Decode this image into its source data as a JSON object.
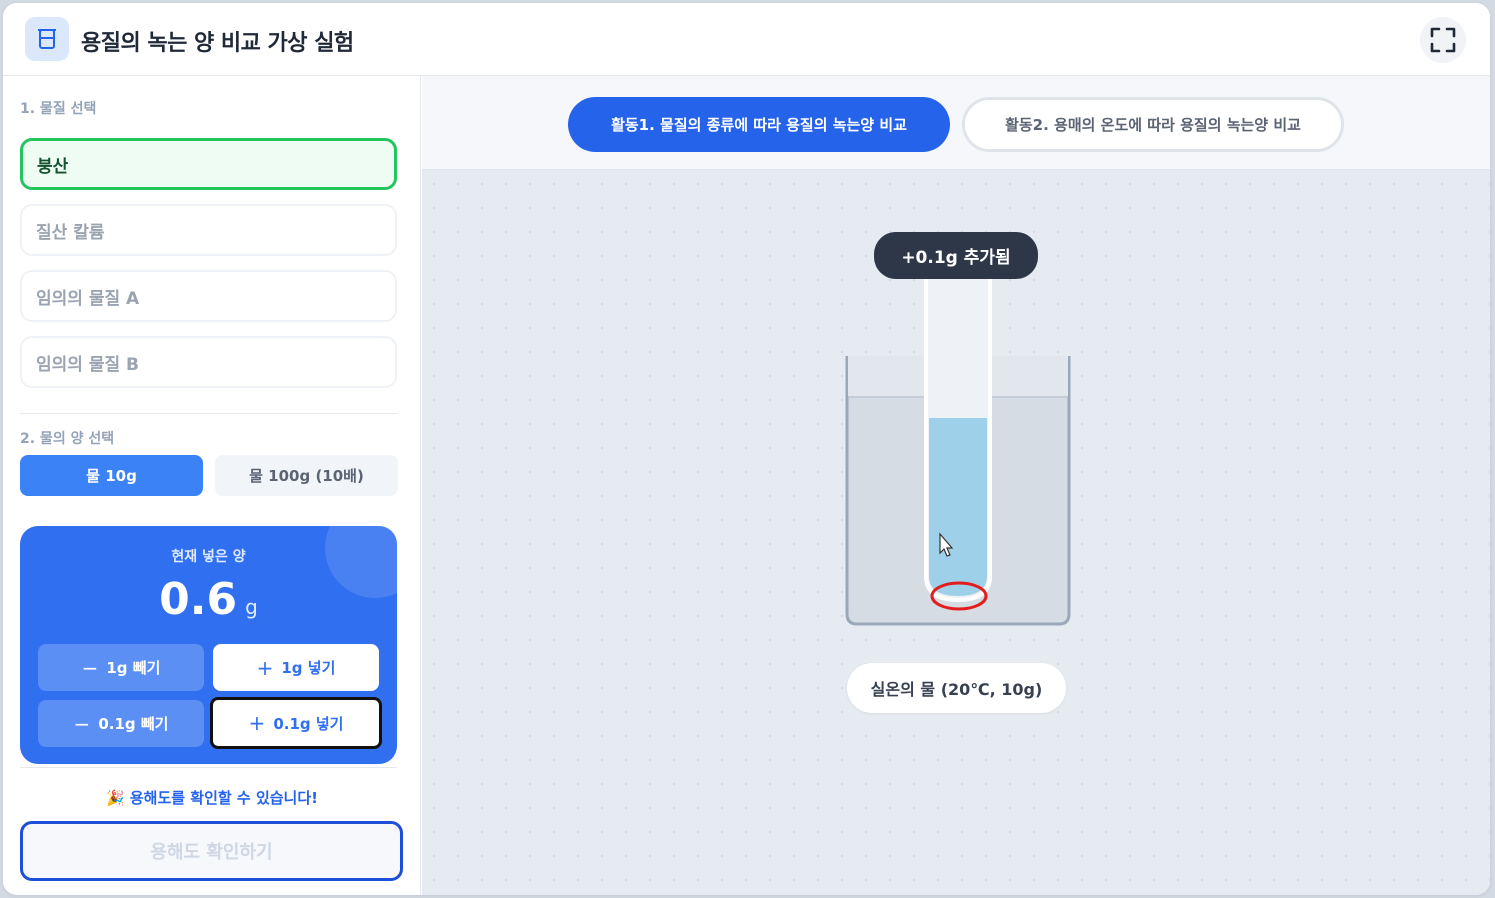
{
  "header": {
    "title": "용질의 녹는 양 비교 가상 실험",
    "icon": "beaker-icon",
    "fullscreen_icon": "fullscreen-icon"
  },
  "sidebar": {
    "section1_label": "1. 물질 선택",
    "substances": [
      "붕산",
      "질산 칼륨",
      "임의의 물질 A",
      "임의의 물질 B"
    ],
    "selected_substance": "붕산",
    "section2_label": "2. 물의 양 선택",
    "water_options": [
      "물 10g",
      "물 100g (10배)"
    ],
    "selected_water": "물 10g",
    "amount": {
      "label": "현재 넣은 양",
      "value": "0.6",
      "unit": "g"
    },
    "buttons": {
      "minus_1g": "1g 빼기",
      "plus_1g": "1g 넣기",
      "minus_01g": "0.1g 빼기",
      "plus_01g": "0.1g 넣기"
    },
    "note": "🎉 용해도를 확인할 수 있습니다!",
    "check_button": "용해도 확인하기"
  },
  "main": {
    "tabs": [
      "활동1. 물질의 종류에 따라 용질의 녹는양 비교",
      "활동2. 용매의 온도에 따라 용질의 녹는양 비교"
    ],
    "active_tab": 0,
    "tooltip": "+0.1g 추가됨",
    "caption": "실온의 물 (20℃, 10g)"
  },
  "colors": {
    "primary": "#2563eb",
    "selected_border": "#22c55e",
    "liquid": "#9fd0ea",
    "highlight": "#e11d1d"
  }
}
